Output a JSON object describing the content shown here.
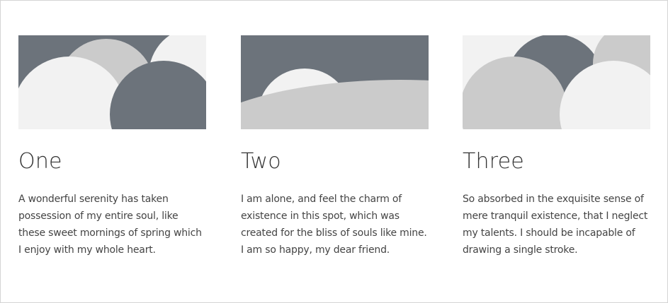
{
  "cards": [
    {
      "title": "One",
      "text": "A wonderful serenity has taken possession of my entire soul, like these sweet mornings of spring which I enjoy with my whole heart.",
      "image": "abstract-circles-placeholder-image"
    },
    {
      "title": "Two",
      "text": "I am alone, and feel the charm of existence in this spot, which was created for the bliss of souls like mine. I am so happy, my dear friend.",
      "image": "abstract-circles-placeholder-image"
    },
    {
      "title": "Three",
      "text": "So absorbed in the exquisite sense of mere tranquil existence, that I neglect my talents. I should be incapable of drawing a single stroke.",
      "image": "abstract-circles-placeholder-image"
    }
  ],
  "colors": {
    "dark": "#6c737b",
    "mid": "#cbcbcb",
    "light": "#f2f2f2",
    "title": "#333333",
    "text": "#444444"
  }
}
